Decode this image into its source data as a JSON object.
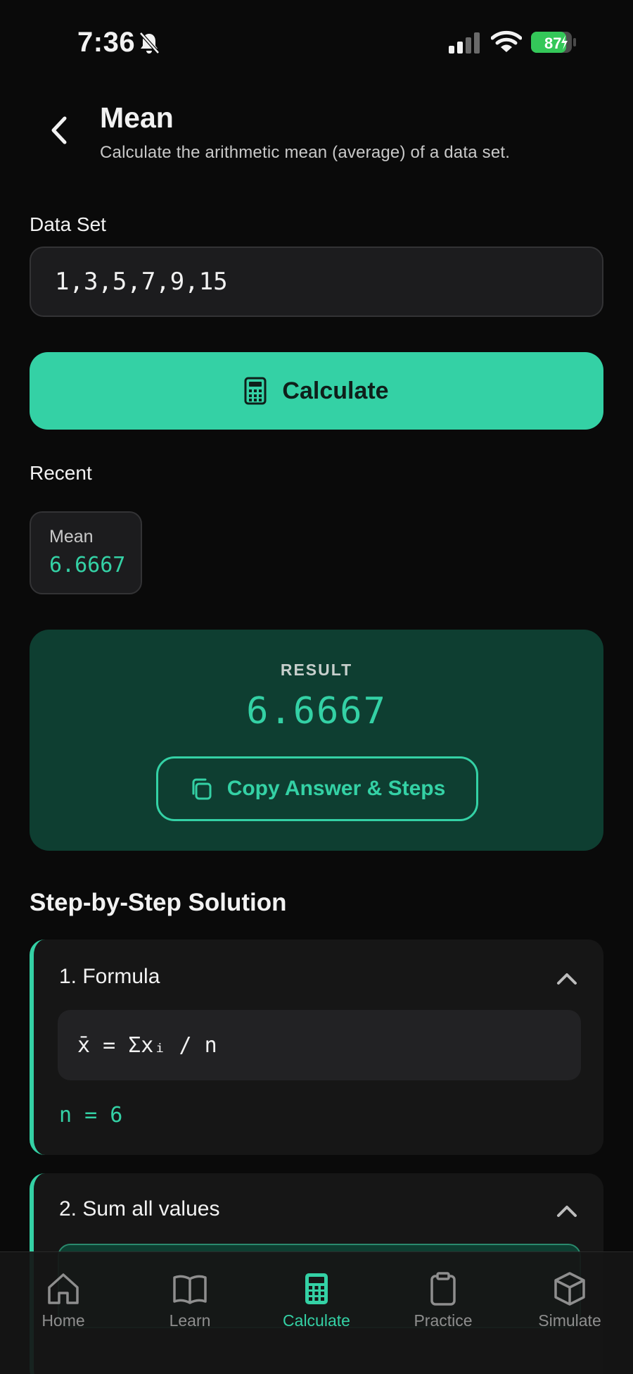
{
  "status": {
    "time": "7:36",
    "battery": "87"
  },
  "header": {
    "title": "Mean",
    "subtitle": "Calculate the arithmetic mean (average) of a data set."
  },
  "data_set": {
    "label": "Data Set",
    "value": "1,3,5,7,9,15"
  },
  "calculate": {
    "label": "Calculate"
  },
  "recent": {
    "label": "Recent",
    "items": [
      {
        "name": "Mean",
        "value": "6.6667"
      }
    ]
  },
  "result": {
    "label": "RESULT",
    "value": "6.6667",
    "copy_label": "Copy Answer & Steps"
  },
  "solution": {
    "title": "Step-by-Step Solution",
    "steps": [
      {
        "title": "1. Formula",
        "formula": "x̄ = Σxᵢ / n",
        "note": "n = 6"
      },
      {
        "title": "2. Sum all values"
      }
    ]
  },
  "tabs": [
    {
      "label": "Home",
      "icon": "home-icon"
    },
    {
      "label": "Learn",
      "icon": "book-icon"
    },
    {
      "label": "Calculate",
      "icon": "calculator-icon",
      "active": true
    },
    {
      "label": "Practice",
      "icon": "clipboard-icon"
    },
    {
      "label": "Simulate",
      "icon": "cube-icon"
    }
  ],
  "colors": {
    "accent": "#34d1a5",
    "background": "#0a0a0a",
    "result_bg": "#0e3e31"
  }
}
